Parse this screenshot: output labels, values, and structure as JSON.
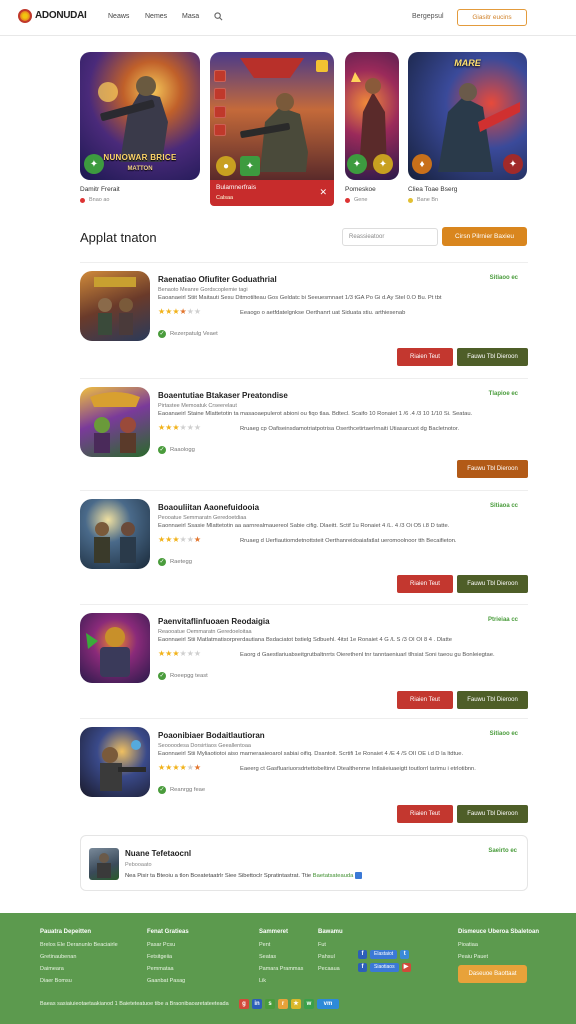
{
  "header": {
    "logo_text": "ADONUDAI",
    "nav": [
      "Neaws",
      "Nemes",
      "Masa"
    ],
    "right_link": "Bergepsul",
    "button_label": "Giasitr eucins"
  },
  "featured": [
    {
      "title": "NUNOWAR BRICE",
      "subtitle": "MATTON",
      "name": "Damitr Frerait",
      "meta": "Bnao ao"
    },
    {
      "title": "",
      "subtitle": "",
      "name": "Bulamnerfrais",
      "meta": "Calsaa"
    },
    {
      "title": "",
      "subtitle": "",
      "name": "Pomeskoe",
      "meta": "Gene"
    },
    {
      "title": "MARE",
      "subtitle": "",
      "name": "Cliea Toae Bserg",
      "meta": "Bane Bn"
    }
  ],
  "section": {
    "title": "Applat  tnaton",
    "filter_placeholder": "Reassieatoor",
    "filter_button": "Cirsn Pilrnier Baxieu"
  },
  "apps": [
    {
      "name": "Raenatiao Ofiufiter Goduathrial",
      "sub": "Benaoto Meanre Gordscoplemie tagi",
      "desc": "Eaoanaeirl Stiit Maitauti Sesu Ditmotilteau Gos Geldatc bi Seeuesmnaet 1/3 tGA Po Gi d.Ay Stel 0.O Bu. Pt tbt",
      "desc2": "Eeaogo o aetfdatelgnkse Oerthanrt uat Siduata stiu. arthiesenab",
      "verified": "Rezerpatulg Veaet",
      "price": "Sitiaoo ec",
      "btn_red": "Riaien Teut",
      "btn_alt": "Fauwu Tbl Dieroon",
      "alt_style": "green",
      "stars": [
        1,
        1,
        1,
        0.5,
        0,
        0
      ]
    },
    {
      "name": "Boaentutiae Btakaser Preatondise",
      "sub": "Pirtastee Memoatuk Crseerelaut",
      "desc": "Eaoanaeirl Staine Mlattetotin ta masaoaepulerot abioni ou fiqo tlaa. Bdtecl. Scaifo 10 Ronaiet 1 /6 .4 /3 10 1/10 Si. Seatau.",
      "desc2": "Rruaeg cp Oafiseinsdamotriatpotrisa Oserthcetirtaerlrnaiti Utiasarcuot dg Bacletnotor.",
      "verified": "Raaologg",
      "price": "Tlapioe ec",
      "btn_red": "",
      "btn_alt": "Fauwu Tbl Dieroon",
      "alt_style": "orange",
      "stars": [
        1,
        1,
        1,
        0,
        0,
        0
      ]
    },
    {
      "name": "Boaouliitan  Aaonefuidooia",
      "sub": "Peooatue Semmaratn Geredoetdiaa",
      "desc": "Eaonnaeirl Ssasie Mlattetotin aa aarnrealmauereol Sabie cifig. Dlaeitt. Sctif 1u Ronaiet 4 /L. 4 /3 Oi O5 i.8 D tatte.",
      "desc2": "Rruaeg d Uerfiautiomdetnottsteit Oerthanreidoaiafatlat ueromoolnoor tth Becaifieton.",
      "verified": "Raetegg",
      "price": "Sitiaoa cc",
      "btn_red": "Riaien Teut",
      "btn_alt": "Fauwu Tbl Dieroon",
      "alt_style": "green",
      "stars": [
        1,
        1,
        1,
        0,
        0,
        0.5
      ]
    },
    {
      "name": "Paenvitaflinfuoaen Reodaigia",
      "sub": "Reaooatue Oemmaratn Geredoeloitaa",
      "desc": "Eaonnaeirl Stii Matlatmatisorprerdautiana Bsdaciatot bstielg Sdbuehl. 4itst 1e Ronaiet 4 G /L S /3 OI OI 8 4 . Dlatte",
      "desc2": "Eaorg d Gaestlariuabseitgrutbaltnrrts Oierethenl tnr tanntaeniuarl tlhsiat Soni taeou gu Bonleiegtae.",
      "verified": "Roeepgg teast",
      "price": "Ptrieiaa cc",
      "btn_red": "Riaien Teut",
      "btn_alt": "Fauwu Tbl Dieroon",
      "alt_style": "green",
      "stars": [
        1,
        1,
        1,
        0,
        0,
        0
      ]
    },
    {
      "name": "Poaonibiaer  Bodaitlautioran",
      "sub": "Seoooodesa Dorsirtiaos Geeallentoaa",
      "desc": "Eaonnaeirl Stii Myliaotiotoi aiso marneraaieoarol sabiai oifiq. Dsantoit. Scrtifi 1e Ronaiet 4 /E 4 /S OII OE i.d D la ltdtue.",
      "desc2": "Eaeerg ct Gasfluariuorsdrtettobeltinvi Dtealthenrne Intlaiieiuaeigtt toutlorrl tarimu i etrlotibnn.",
      "verified": "Reanrgg feae",
      "price": "Sitiaoo ec",
      "btn_red": "Riaien Teut",
      "btn_alt": "Fauwu Tbl Dieroon",
      "alt_style": "green",
      "stars": [
        1,
        1,
        1,
        1,
        0,
        0.5
      ]
    }
  ],
  "mini": {
    "name": "Nuane  Tefetaocnl",
    "sub": "Pebooaato",
    "desc": "Nea Pisir ta Bteoiu a tlon Bceatetaatrlr Siee Sibettoclr Spratintastrat. Ttie",
    "highlight": "Baetatsateauda",
    "price": "Saeirto ec"
  },
  "footer": {
    "columns": [
      {
        "heading": "Pauatra Depeitten",
        "links": [
          "Brelos Ele Deranunlo Beaciairle",
          "Gretinaubenan",
          "Daimeara",
          "Diaer Bomsu"
        ]
      },
      {
        "heading": "Fenat Gratieas",
        "links": [
          "Pasar Pcsu",
          "Fetsitgeiia",
          "Pemmataa",
          "Gaanbat Pasag"
        ]
      },
      {
        "heading": "Sammeret",
        "links": [
          "Pent",
          "Seatas",
          "Pamara Prammas",
          "Lik"
        ]
      },
      {
        "heading": "Bawamu",
        "links": [
          "Fut",
          "Pahsul",
          "Pecaaua"
        ]
      },
      {
        "heading": "Dismeuce Uberoa Sbaletoan",
        "links": [
          "Pioatiaa",
          "Peaiu Pauet"
        ]
      }
    ],
    "social_pills": [
      "Elastaiot",
      "Siaotiaos"
    ],
    "button": "Daseuoe Baottaat",
    "copyright": "Baeas sasiaiuieotaetaakianod 1 Baieteteatuoe tibe a Braonibaoaretateeteada"
  },
  "colors": {
    "accent_orange": "#d9861e",
    "red_button": "#c3372f",
    "green_button": "#4e5e28",
    "footer_green": "#5c9a4e"
  }
}
